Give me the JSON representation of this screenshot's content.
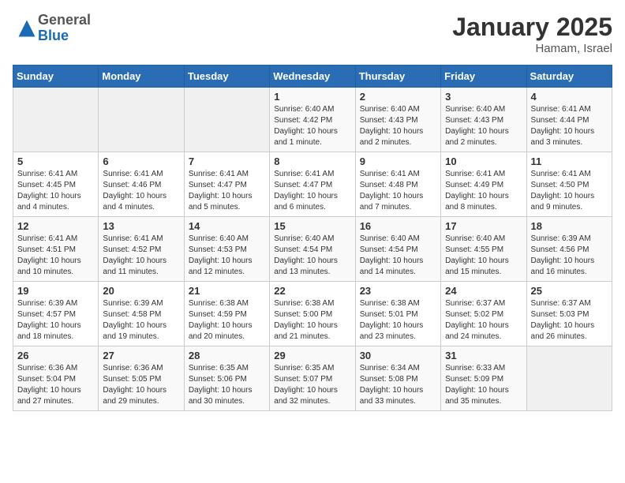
{
  "header": {
    "logo_general": "General",
    "logo_blue": "Blue",
    "month_title": "January 2025",
    "location": "Hamam, Israel"
  },
  "days_of_week": [
    "Sunday",
    "Monday",
    "Tuesday",
    "Wednesday",
    "Thursday",
    "Friday",
    "Saturday"
  ],
  "weeks": [
    [
      {
        "day": "",
        "info": ""
      },
      {
        "day": "",
        "info": ""
      },
      {
        "day": "",
        "info": ""
      },
      {
        "day": "1",
        "info": "Sunrise: 6:40 AM\nSunset: 4:42 PM\nDaylight: 10 hours\nand 1 minute."
      },
      {
        "day": "2",
        "info": "Sunrise: 6:40 AM\nSunset: 4:43 PM\nDaylight: 10 hours\nand 2 minutes."
      },
      {
        "day": "3",
        "info": "Sunrise: 6:40 AM\nSunset: 4:43 PM\nDaylight: 10 hours\nand 2 minutes."
      },
      {
        "day": "4",
        "info": "Sunrise: 6:41 AM\nSunset: 4:44 PM\nDaylight: 10 hours\nand 3 minutes."
      }
    ],
    [
      {
        "day": "5",
        "info": "Sunrise: 6:41 AM\nSunset: 4:45 PM\nDaylight: 10 hours\nand 4 minutes."
      },
      {
        "day": "6",
        "info": "Sunrise: 6:41 AM\nSunset: 4:46 PM\nDaylight: 10 hours\nand 4 minutes."
      },
      {
        "day": "7",
        "info": "Sunrise: 6:41 AM\nSunset: 4:47 PM\nDaylight: 10 hours\nand 5 minutes."
      },
      {
        "day": "8",
        "info": "Sunrise: 6:41 AM\nSunset: 4:47 PM\nDaylight: 10 hours\nand 6 minutes."
      },
      {
        "day": "9",
        "info": "Sunrise: 6:41 AM\nSunset: 4:48 PM\nDaylight: 10 hours\nand 7 minutes."
      },
      {
        "day": "10",
        "info": "Sunrise: 6:41 AM\nSunset: 4:49 PM\nDaylight: 10 hours\nand 8 minutes."
      },
      {
        "day": "11",
        "info": "Sunrise: 6:41 AM\nSunset: 4:50 PM\nDaylight: 10 hours\nand 9 minutes."
      }
    ],
    [
      {
        "day": "12",
        "info": "Sunrise: 6:41 AM\nSunset: 4:51 PM\nDaylight: 10 hours\nand 10 minutes."
      },
      {
        "day": "13",
        "info": "Sunrise: 6:41 AM\nSunset: 4:52 PM\nDaylight: 10 hours\nand 11 minutes."
      },
      {
        "day": "14",
        "info": "Sunrise: 6:40 AM\nSunset: 4:53 PM\nDaylight: 10 hours\nand 12 minutes."
      },
      {
        "day": "15",
        "info": "Sunrise: 6:40 AM\nSunset: 4:54 PM\nDaylight: 10 hours\nand 13 minutes."
      },
      {
        "day": "16",
        "info": "Sunrise: 6:40 AM\nSunset: 4:54 PM\nDaylight: 10 hours\nand 14 minutes."
      },
      {
        "day": "17",
        "info": "Sunrise: 6:40 AM\nSunset: 4:55 PM\nDaylight: 10 hours\nand 15 minutes."
      },
      {
        "day": "18",
        "info": "Sunrise: 6:39 AM\nSunset: 4:56 PM\nDaylight: 10 hours\nand 16 minutes."
      }
    ],
    [
      {
        "day": "19",
        "info": "Sunrise: 6:39 AM\nSunset: 4:57 PM\nDaylight: 10 hours\nand 18 minutes."
      },
      {
        "day": "20",
        "info": "Sunrise: 6:39 AM\nSunset: 4:58 PM\nDaylight: 10 hours\nand 19 minutes."
      },
      {
        "day": "21",
        "info": "Sunrise: 6:38 AM\nSunset: 4:59 PM\nDaylight: 10 hours\nand 20 minutes."
      },
      {
        "day": "22",
        "info": "Sunrise: 6:38 AM\nSunset: 5:00 PM\nDaylight: 10 hours\nand 21 minutes."
      },
      {
        "day": "23",
        "info": "Sunrise: 6:38 AM\nSunset: 5:01 PM\nDaylight: 10 hours\nand 23 minutes."
      },
      {
        "day": "24",
        "info": "Sunrise: 6:37 AM\nSunset: 5:02 PM\nDaylight: 10 hours\nand 24 minutes."
      },
      {
        "day": "25",
        "info": "Sunrise: 6:37 AM\nSunset: 5:03 PM\nDaylight: 10 hours\nand 26 minutes."
      }
    ],
    [
      {
        "day": "26",
        "info": "Sunrise: 6:36 AM\nSunset: 5:04 PM\nDaylight: 10 hours\nand 27 minutes."
      },
      {
        "day": "27",
        "info": "Sunrise: 6:36 AM\nSunset: 5:05 PM\nDaylight: 10 hours\nand 29 minutes."
      },
      {
        "day": "28",
        "info": "Sunrise: 6:35 AM\nSunset: 5:06 PM\nDaylight: 10 hours\nand 30 minutes."
      },
      {
        "day": "29",
        "info": "Sunrise: 6:35 AM\nSunset: 5:07 PM\nDaylight: 10 hours\nand 32 minutes."
      },
      {
        "day": "30",
        "info": "Sunrise: 6:34 AM\nSunset: 5:08 PM\nDaylight: 10 hours\nand 33 minutes."
      },
      {
        "day": "31",
        "info": "Sunrise: 6:33 AM\nSunset: 5:09 PM\nDaylight: 10 hours\nand 35 minutes."
      },
      {
        "day": "",
        "info": ""
      }
    ]
  ]
}
